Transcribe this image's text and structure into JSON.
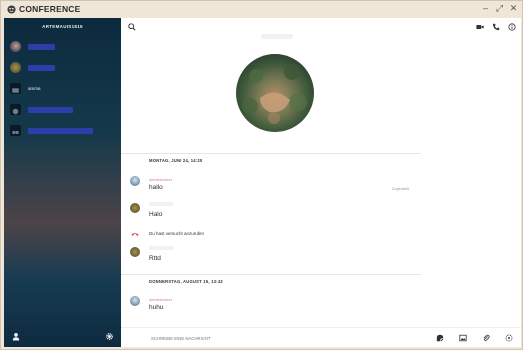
{
  "window": {
    "title": "CONFERENCE",
    "controls": {
      "minimize": "–",
      "maximize": "⤢",
      "close": "✕"
    }
  },
  "sidebar": {
    "account": "ARTEMAUIS1815",
    "contacts": [
      {
        "label": "",
        "avatar": "photo"
      },
      {
        "label": "",
        "avatar": "photo-tree"
      },
      {
        "label": "amma",
        "avatar": "dark-square"
      },
      {
        "label": "",
        "avatar": "dark-square"
      },
      {
        "label": "",
        "avatar": "dark-square"
      }
    ]
  },
  "chat": {
    "messages": [
      {
        "type": "date",
        "text": "MONTAG, JUNI 24, 14:20"
      },
      {
        "type": "message",
        "sender": "nineteenseer",
        "body": "hallo",
        "state": "Zugestellt"
      },
      {
        "type": "message",
        "sender": "",
        "body": "Halo"
      },
      {
        "type": "call",
        "text": "Du hast versucht anzurufen"
      },
      {
        "type": "message",
        "sender": "",
        "body": "Rttd"
      },
      {
        "type": "date",
        "text": "DONNERSTAG, AUGUST 15, 13:43"
      },
      {
        "type": "message",
        "sender": "nineteenseer",
        "body": "huhu"
      }
    ]
  },
  "composer": {
    "placeholder": "SCHREIBE EINE NACHRICHT"
  },
  "colors": {
    "accent_sender": "#e26db0",
    "sidebar_dark": "#0c2a3e",
    "titlebar": "#efe6d8"
  }
}
